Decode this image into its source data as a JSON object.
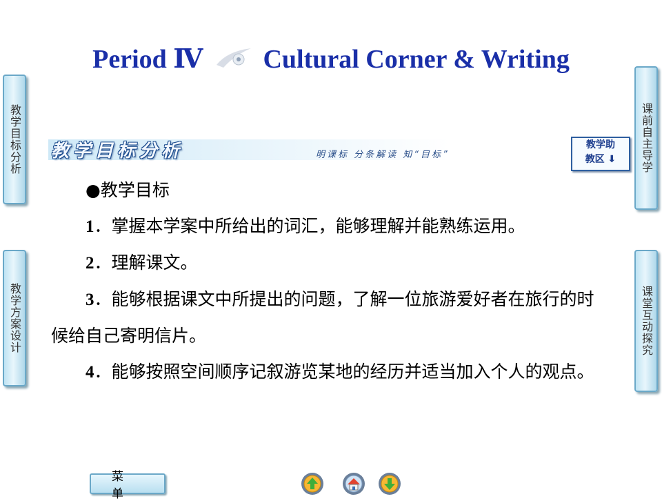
{
  "title": {
    "left": "Period Ⅳ",
    "right": "Cultural Corner & Writing"
  },
  "left_tabs": [
    {
      "label": "教学目标分析"
    },
    {
      "label": "教学方案设计"
    }
  ],
  "right_tabs": [
    {
      "label": "课前自主导学"
    },
    {
      "label": "课堂互动探究"
    }
  ],
  "banner": {
    "title": "教学目标分析",
    "subtitle": "明课标 分条解读 知“目标”"
  },
  "assist_button": {
    "line1": "教学助",
    "line2": "教区"
  },
  "content": {
    "heading": "●教学目标",
    "items": [
      {
        "num": "1",
        "text": "．掌握本学案中所给出的词汇，能够理解并能熟练运用。"
      },
      {
        "num": "2",
        "text": "．理解课文。"
      },
      {
        "num": "3",
        "text": "．能够根据课文中所提出的问题，了解一位旅游爱好者在旅行的时候给自己寄明信片。"
      },
      {
        "num": "4",
        "text": "．能够按照空间顺序记叙游览某地的经历并适当加入个人的观点。"
      }
    ]
  },
  "footer": {
    "menu_label": "菜单"
  },
  "nav_icons": [
    "back-arrow-icon",
    "home-icon",
    "forward-arrow-icon"
  ]
}
